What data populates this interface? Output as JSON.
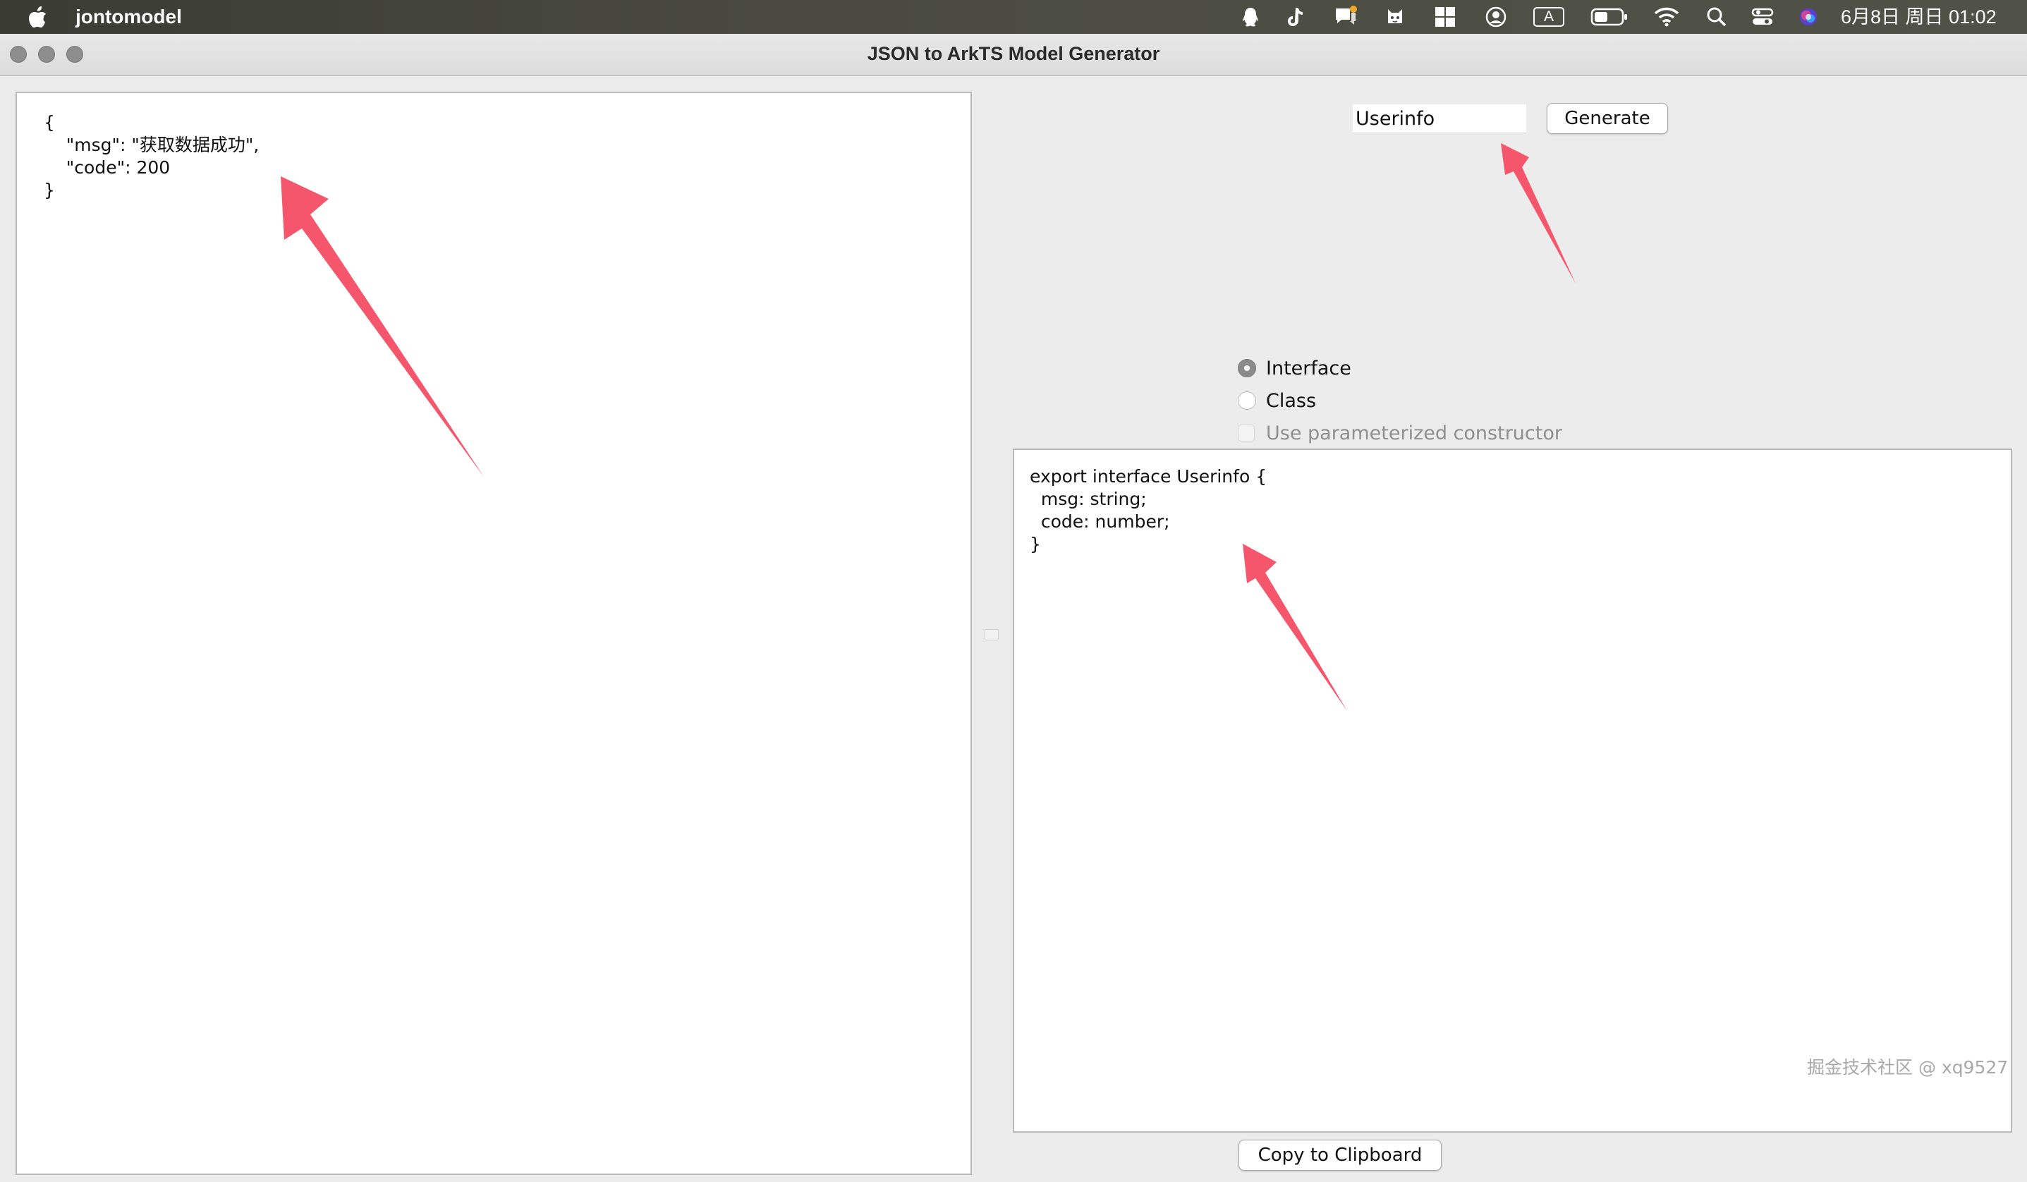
{
  "menubar": {
    "app_name": "jontomodel",
    "clock": "6月8日 周日 01:02",
    "status_icons": [
      "qq-icon",
      "tiktok-icon",
      "notification-icon",
      "cat-app-icon",
      "grid-app-icon",
      "user-circle-icon",
      "input-method-icon",
      "battery-icon",
      "wifi-icon",
      "search-icon",
      "control-center-icon",
      "siri-icon"
    ],
    "input_method_label": "A"
  },
  "window": {
    "title": "JSON to ArkTS Model Generator"
  },
  "json_input": {
    "lines": [
      "{",
      "    \"msg\": \"获取数据成功\",",
      "    \"code\": 200",
      "}"
    ]
  },
  "controls": {
    "class_name_value": "Userinfo",
    "generate_label": "Generate",
    "option_interface": "Interface",
    "option_class": "Class",
    "option_constructor": "Use parameterized constructor",
    "selected_option": "Interface",
    "copy_label": "Copy to Clipboard"
  },
  "output": {
    "lines": [
      "export interface Userinfo {",
      "  msg: string;",
      "  code: number;",
      "}"
    ]
  },
  "watermark": "掘金技术社区 @ xq9527",
  "colors": {
    "annotation_arrow": "#f5566c",
    "menubar_bg": "#4a4a40",
    "window_bg": "#ececec"
  }
}
